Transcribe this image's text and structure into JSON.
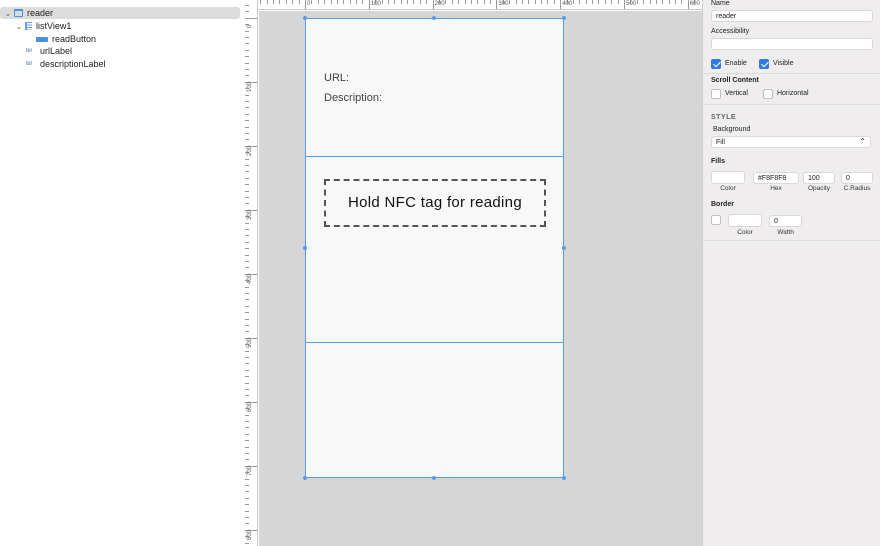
{
  "tree": {
    "items": [
      {
        "label": "reader",
        "icon": "view-icon",
        "expanded": true,
        "selected": true
      },
      {
        "label": "listView1",
        "icon": "list-icon",
        "expanded": true
      },
      {
        "label": "readButton",
        "icon": "button-icon"
      },
      {
        "label": "urlLabel",
        "icon": "label-icon"
      },
      {
        "label": "descriptionLabel",
        "icon": "label-icon"
      }
    ],
    "label_icon_text": "lbl"
  },
  "rulers": {
    "horizontal": [
      "100",
      "0",
      "100",
      "200",
      "300",
      "400",
      "500",
      "600"
    ],
    "vertical": [
      "0",
      "100",
      "200",
      "300",
      "400",
      "500",
      "600",
      "700",
      "800"
    ]
  },
  "form": {
    "url_label": "URL:",
    "description_label": "Description:",
    "read_button_label": "Hold NFC tag for reading"
  },
  "inspector": {
    "name_label": "Name",
    "name_value": "reader",
    "accessibility_label": "Accessibility",
    "accessibility_value": "",
    "enable_label": "Enable",
    "visible_label": "Visible",
    "enable_checked": true,
    "visible_checked": true,
    "scroll_title": "Scroll Content",
    "vertical_label": "Vertical",
    "horizontal_label": "Horizontal",
    "style_title": "STYLE",
    "background_label": "Background",
    "background_value": "Fill",
    "fills_title": "Fills",
    "fill_hex": "#F8F8F8",
    "fill_opacity": "100",
    "fill_radius": "0",
    "color_caption": "Color",
    "hex_caption": "Hex",
    "opacity_caption": "Opacity",
    "radius_caption": "C.Radius",
    "border_title": "Border",
    "border_width": "0",
    "border_color_caption": "Color",
    "width_caption": "Width"
  },
  "colors": {
    "accent": "#2f7ae5",
    "selection": "#5a9de6",
    "form_bg": "#f8f8f8",
    "canvas_bg": "#d6d6d6"
  }
}
